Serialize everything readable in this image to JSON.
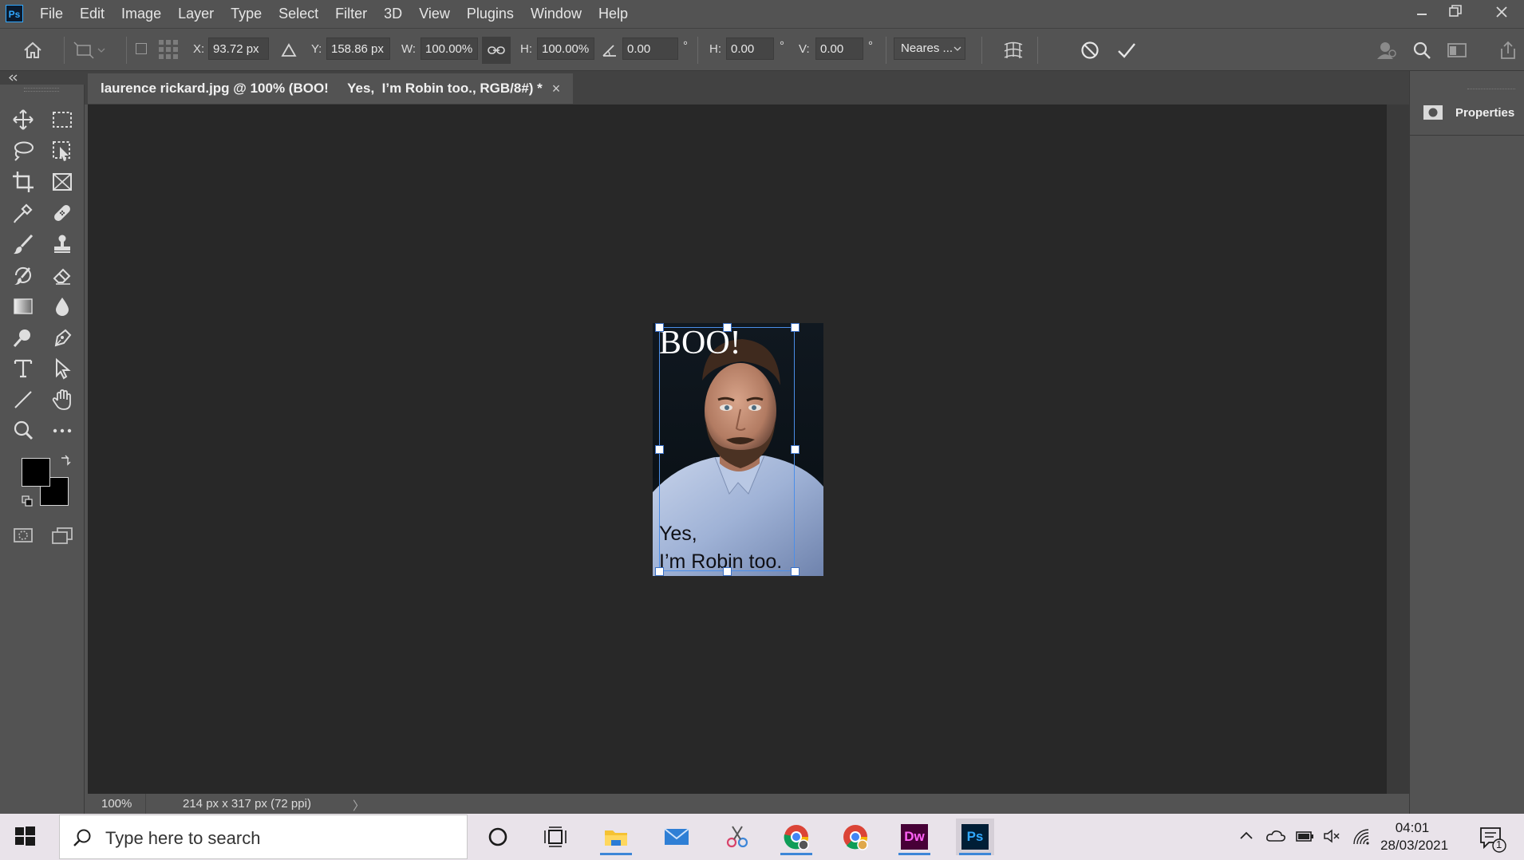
{
  "app": {
    "logo_text": "Ps"
  },
  "menu": [
    "File",
    "Edit",
    "Image",
    "Layer",
    "Type",
    "Select",
    "Filter",
    "3D",
    "View",
    "Plugins",
    "Window",
    "Help"
  ],
  "options": {
    "x_label": "X:",
    "x_value": "93.72 px",
    "y_label": "Y:",
    "y_value": "158.86 px",
    "w_label": "W:",
    "w_value": "100.00%",
    "h_label": "H:",
    "h_value": "100.00%",
    "angle_value": "0.00",
    "degree": "°",
    "hskew_label": "H:",
    "hskew_value": "0.00",
    "vskew_label": "V:",
    "vskew_value": "0.00",
    "interpolation": "Neares ..."
  },
  "document": {
    "tab_title": "laurence rickard.jpg @ 100% (BOO!     Yes,  I’m Robin too., RGB/8#) *",
    "close": "×"
  },
  "image_text": {
    "top": "BOO!",
    "bottom_line1": "Yes,",
    "bottom_line2": "I’m Robin too."
  },
  "status": {
    "zoom": "100%",
    "doc_info": "214 px x 317 px (72 ppi)",
    "arrow": "〉"
  },
  "panel": {
    "title": "Properties"
  },
  "taskbar": {
    "search_placeholder": "Type here to search",
    "time": "04:01",
    "date": "28/03/2021",
    "notifications": "1",
    "dw_label": "Dw",
    "ps_label": "Ps"
  },
  "colors": {
    "accent": "#31a8ff",
    "dw": "#470137",
    "dw_text": "#ff61f6",
    "ps_bg": "#001e36"
  }
}
